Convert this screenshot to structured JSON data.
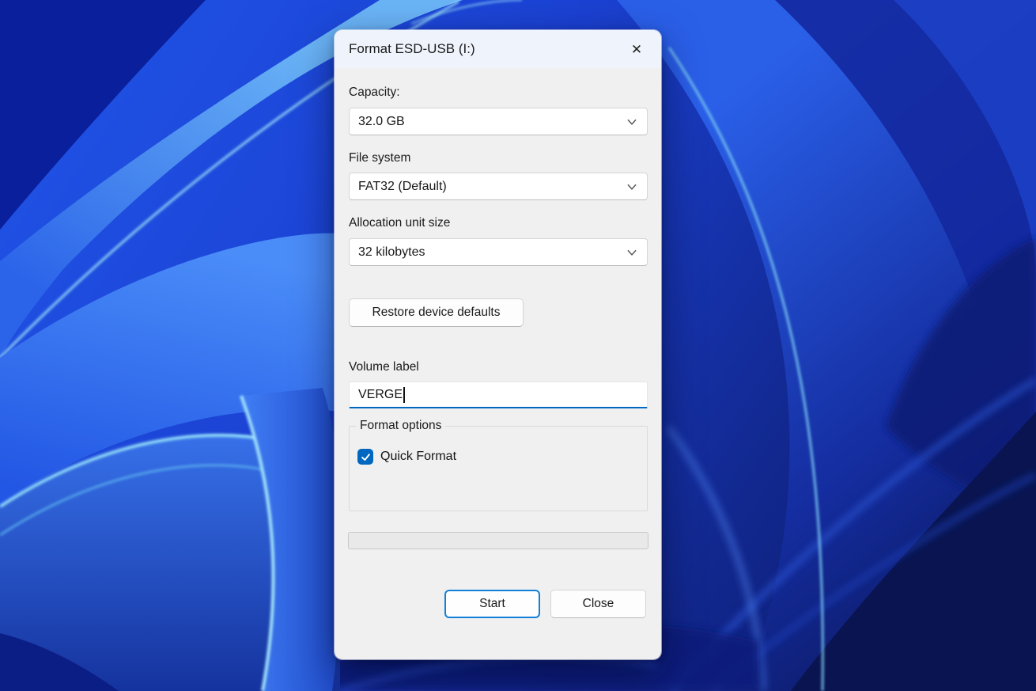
{
  "window": {
    "title": "Format ESD-USB (I:)"
  },
  "icons": {
    "close": "✕",
    "chevron": "chevron-down",
    "check": "checkmark"
  },
  "fields": {
    "capacity": {
      "label": "Capacity:",
      "value": "32.0 GB"
    },
    "file_system": {
      "label": "File system",
      "value": "FAT32 (Default)"
    },
    "allocation_unit": {
      "label": "Allocation unit size",
      "value": "32 kilobytes"
    }
  },
  "buttons": {
    "restore": "Restore device defaults",
    "start": "Start",
    "close": "Close"
  },
  "volume": {
    "label": "Volume label",
    "value": "VERGE"
  },
  "format_options": {
    "legend": "Format options",
    "quick_format": "Quick Format",
    "quick_format_checked": true
  },
  "progress": {
    "percent": 0
  },
  "colors": {
    "accent": "#0067c0",
    "start_button_border": "#1280d8",
    "dialog_bg": "#f0f0f0",
    "titlebar_bg": "#eff3fb",
    "wallpaper_bright": "#2b63e9",
    "wallpaper_dark": "#0a1560",
    "wallpaper_edge": "#8fd9f8"
  }
}
